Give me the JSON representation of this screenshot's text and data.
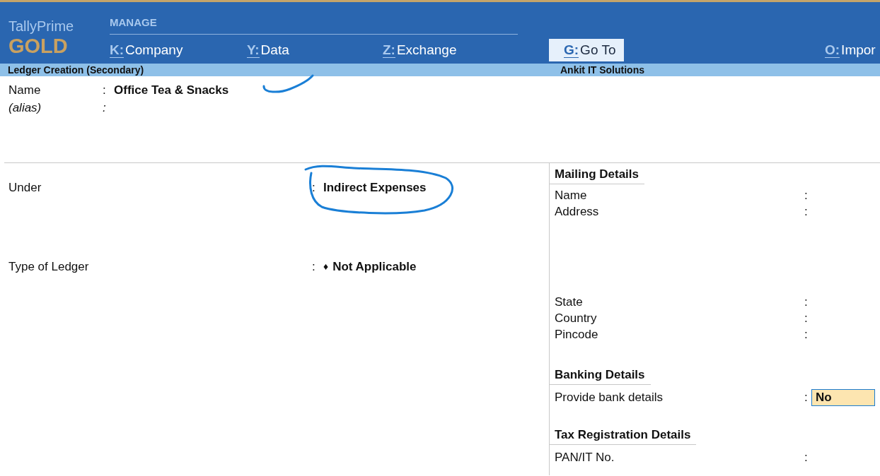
{
  "app": {
    "product": "TallyPrime",
    "edition": "GOLD"
  },
  "menu": {
    "title": "MANAGE",
    "items": [
      {
        "key": "K:",
        "label": "Company",
        "selected": false
      },
      {
        "key": "Y:",
        "label": "Data",
        "selected": false
      },
      {
        "key": "Z:",
        "label": "Exchange",
        "selected": false
      },
      {
        "key": "G:",
        "label": "Go To",
        "selected": true
      },
      {
        "key": "O:",
        "label": "Impor",
        "selected": false
      }
    ]
  },
  "header": {
    "screen": "Ledger Creation (Secondary)",
    "company": "Ankit IT Solutions"
  },
  "identity": [
    {
      "label": "Name",
      "separator": ":",
      "value": "Office Tea & Snacks",
      "kind": "plain"
    },
    {
      "label": "(alias)",
      "separator": ":",
      "kind": "alias"
    }
  ],
  "classification": [
    {
      "label": "Under",
      "separator": ":",
      "value": "Indirect Expenses"
    },
    {
      "label": "Type of Ledger",
      "separator": ":",
      "marker": "♦",
      "value": "Not Applicable"
    }
  ],
  "sections": [
    {
      "title": "Mailing Details",
      "fields": [
        {
          "label": "Name",
          "separator": ":",
          "kind": "line"
        },
        {
          "label": "Address",
          "separator": ":",
          "kind": "block"
        },
        {
          "label": "State",
          "separator": ":",
          "kind": "line"
        },
        {
          "label": "Country",
          "separator": ":",
          "kind": "line"
        },
        {
          "label": "Pincode",
          "separator": ":",
          "kind": "line"
        }
      ]
    },
    {
      "title": "Banking Details",
      "fields": [
        {
          "label": "Provide bank details",
          "separator": ":",
          "kind": "line",
          "value": "No",
          "focused": true
        }
      ]
    },
    {
      "title": "Tax Registration Details",
      "fields": [
        {
          "label": "PAN/IT No.",
          "separator": ":",
          "kind": "line"
        }
      ]
    }
  ]
}
